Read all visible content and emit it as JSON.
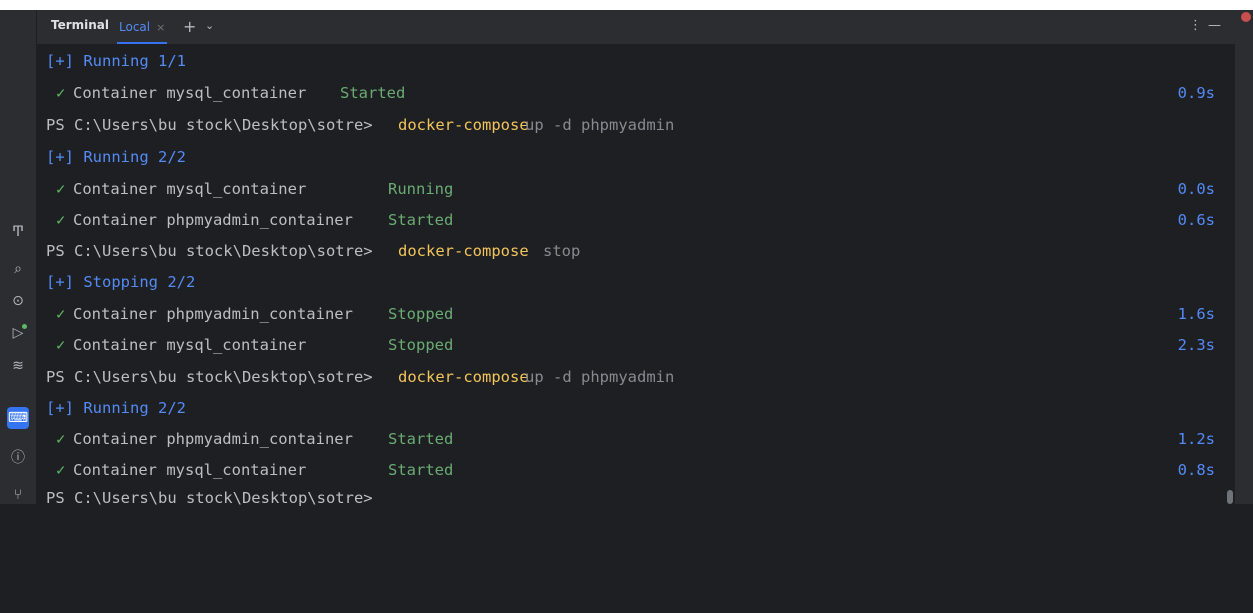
{
  "tabs": {
    "title": "Terminal",
    "active_tab": "Local",
    "close_symbol": "×",
    "add_symbol": "+",
    "menu_symbol": "⌄",
    "more_symbol": "⋮",
    "minimize_symbol": "—"
  },
  "sidebar": {
    "icons": [
      "text-format-icon",
      "search-icon",
      "play-icon",
      "run-icon",
      "layers-icon",
      "terminal-icon",
      "problems-icon",
      "git-icon"
    ]
  },
  "colors": {
    "background": "#1e1f22",
    "accent": "#3574f0",
    "prompt": "#bcbec4",
    "command": "#f2c55c",
    "status_blue": "#548af7",
    "status_green": "#5fb865"
  },
  "terminal": {
    "lines": [
      {
        "status": "[+] Running 1/1"
      },
      {
        "check": "✓",
        "container": "Container mysql_container",
        "state": "Started",
        "time": "0.9s"
      },
      {
        "prompt": "PS C:\\Users\\bu stock\\Desktop\\sotre>",
        "command": "docker-compose",
        "args": "up -d phpmyadmin"
      },
      {
        "status": "[+] Running 2/2"
      },
      {
        "check": "✓",
        "container": "Container mysql_container",
        "state": "Running",
        "time": "0.0s"
      },
      {
        "check": "✓",
        "container": "Container phpmyadmin_container",
        "state": "Started",
        "time": "0.6s"
      },
      {
        "prompt": "PS C:\\Users\\bu stock\\Desktop\\sotre>",
        "command": "docker-compose",
        "args": "stop"
      },
      {
        "status": "[+] Stopping 2/2"
      },
      {
        "check": "✓",
        "container": "Container phpmyadmin_container",
        "state": "Stopped",
        "time": "1.6s"
      },
      {
        "check": "✓",
        "container": "Container mysql_container",
        "state": "Stopped",
        "time": "2.3s"
      },
      {
        "prompt": "PS C:\\Users\\bu stock\\Desktop\\sotre>",
        "command": "docker-compose",
        "args": "up -d phpmyadmin"
      },
      {
        "status": "[+] Running 2/2"
      },
      {
        "check": "✓",
        "container": "Container phpmyadmin_container",
        "state": "Started",
        "time": "1.2s"
      },
      {
        "check": "✓",
        "container": "Container mysql_container",
        "state": "Started",
        "time": "0.8s"
      },
      {
        "prompt": "PS C:\\Users\\bu stock\\Desktop\\sotre>"
      }
    ]
  }
}
